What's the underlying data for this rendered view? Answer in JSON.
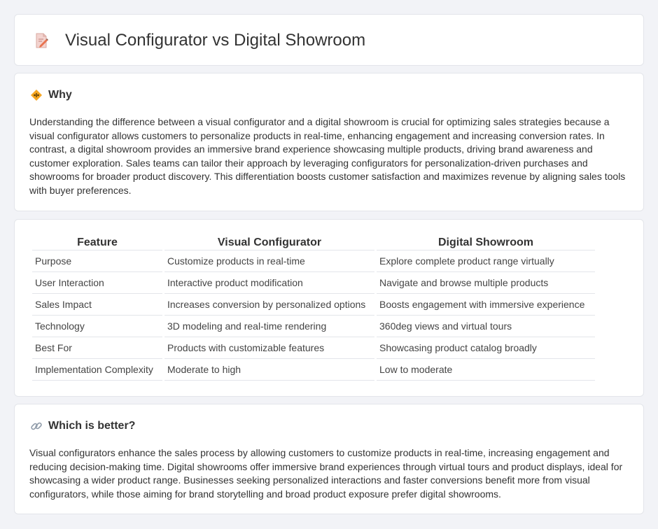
{
  "page": {
    "title": "Visual Configurator vs Digital Showroom"
  },
  "icons": {
    "title": "document-pen-icon",
    "why": "warning-diamond-icon",
    "better": "link-icon"
  },
  "why": {
    "heading": "Why",
    "text": "Understanding the difference between a visual configurator and a digital showroom is crucial for optimizing sales strategies because a visual configurator allows customers to personalize products in real-time, enhancing engagement and increasing conversion rates. In contrast, a digital showroom provides an immersive brand experience showcasing multiple products, driving brand awareness and customer exploration. Sales teams can tailor their approach by leveraging configurators for personalization-driven purchases and showrooms for broader product discovery. This differentiation boosts customer satisfaction and maximizes revenue by aligning sales tools with buyer preferences."
  },
  "table": {
    "headers": [
      "Feature",
      "Visual Configurator",
      "Digital Showroom"
    ],
    "rows": [
      [
        "Purpose",
        "Customize products in real-time",
        "Explore complete product range virtually"
      ],
      [
        "User Interaction",
        "Interactive product modification",
        "Navigate and browse multiple products"
      ],
      [
        "Sales Impact",
        "Increases conversion by personalized options",
        "Boosts engagement with immersive experience"
      ],
      [
        "Technology",
        "3D modeling and real-time rendering",
        "360deg views and virtual tours"
      ],
      [
        "Best For",
        "Products with customizable features",
        "Showcasing product catalog broadly"
      ],
      [
        "Implementation Complexity",
        "Moderate to high",
        "Low to moderate"
      ]
    ]
  },
  "better": {
    "heading": "Which is better?",
    "text": "Visual configurators enhance the sales process by allowing customers to customize products in real-time, increasing engagement and reducing decision-making time. Digital showrooms offer immersive brand experiences through virtual tours and product displays, ideal for showcasing a wider product range. Businesses seeking personalized interactions and faster conversions benefit more from visual configurators, while those aiming for brand storytelling and broad product exposure prefer digital showrooms."
  }
}
